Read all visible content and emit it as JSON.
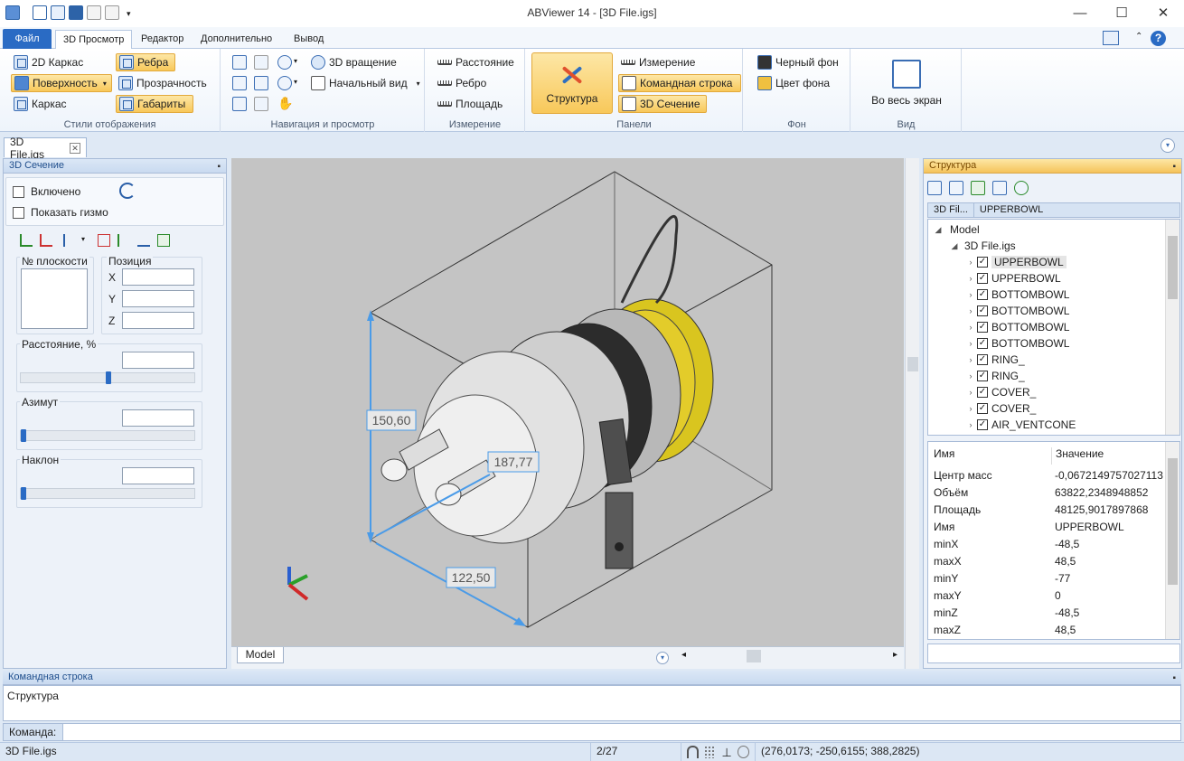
{
  "window": {
    "title": "ABViewer 14 - [3D File.igs]",
    "minimize": "—",
    "maximize": "☐",
    "close": "✕"
  },
  "ribbon_tabs": [
    "Файл",
    "3D Просмотр",
    "Редактор",
    "Дополнительно",
    "Вывод"
  ],
  "ribbon": {
    "display": {
      "label": "Стили отображения",
      "frame2d": "2D Каркас",
      "surface": "Поверхность",
      "wireframe": "Каркас",
      "edges": "Ребра",
      "transparency": "Прозрачность",
      "bounds": "Габариты"
    },
    "nav": {
      "label": "Навигация и просмотр",
      "rotate3d": "3D вращение",
      "initial_view": "Начальный вид"
    },
    "measure": {
      "label": "Измерение",
      "distance": "Расстояние",
      "edge": "Ребро",
      "area": "Площадь"
    },
    "panels": {
      "label": "Панели",
      "structure": "Структура",
      "measurement": "Измерение",
      "command_line": "Командная строка",
      "section3d": "3D Сечение"
    },
    "background": {
      "label": "Фон",
      "black_bg": "Черный фон",
      "bg_color": "Цвет фона"
    },
    "view": {
      "label": "Вид",
      "fullscreen": "Во весь экран"
    }
  },
  "doc_tab": "3D File.igs",
  "section_panel": {
    "title": "3D Сечение",
    "enabled": "Включено",
    "show_gizmo": "Показать гизмо",
    "plane_no": "№ плоскости",
    "position": "Позиция",
    "x": "X",
    "y": "Y",
    "z": "Z",
    "distance": "Расстояние, %",
    "azimuth": "Азимут",
    "tilt": "Наклон",
    "distance_level": 0.5,
    "azimuth_level": 0.0,
    "tilt_level": 0.0
  },
  "viewport": {
    "dim_height": "150,60",
    "dim_depth": "187,77",
    "dim_width": "122,50",
    "model_tab": "Model"
  },
  "structure_panel": {
    "title": "Структура",
    "crumb1": "3D Fil...",
    "crumb2": "UPPERBOWL",
    "tree_root": "Model",
    "tree_file": "3D File.igs",
    "items": [
      "UPPERBOWL",
      "UPPERBOWL",
      "BOTTOMBOWL",
      "BOTTOMBOWL",
      "BOTTOMBOWL",
      "BOTTOMBOWL",
      "RING_",
      "RING_",
      "COVER_",
      "COVER_",
      "AIR_VENTCONE"
    ],
    "checkmark": "✓",
    "props_header": {
      "name": "Имя",
      "value": "Значение"
    },
    "props": [
      {
        "k": "Центр масс",
        "v": "-0,0672149757027113"
      },
      {
        "k": "Объём",
        "v": "63822,2348948852"
      },
      {
        "k": "Площадь",
        "v": "48125,9017897868"
      },
      {
        "k": "Имя",
        "v": "UPPERBOWL"
      },
      {
        "k": "minX",
        "v": "-48,5"
      },
      {
        "k": "maxX",
        "v": "48,5"
      },
      {
        "k": "minY",
        "v": "-77"
      },
      {
        "k": "maxY",
        "v": "0"
      },
      {
        "k": "minZ",
        "v": "-48,5"
      },
      {
        "k": "maxZ",
        "v": "48,5"
      }
    ]
  },
  "command": {
    "title": "Командная строка",
    "output": "Структура",
    "prompt": "Команда:"
  },
  "status": {
    "file": "3D File.igs",
    "page": "2/27",
    "coords": "(276,0173; -250,6155; 388,2825)"
  },
  "colors": {
    "accent": "#2a6bc4",
    "highlight": "#f8c85a",
    "viewport_bg": "#c4c4c4",
    "dimension": "#4a9be8",
    "cap_yellow": "#e3cc2a"
  }
}
